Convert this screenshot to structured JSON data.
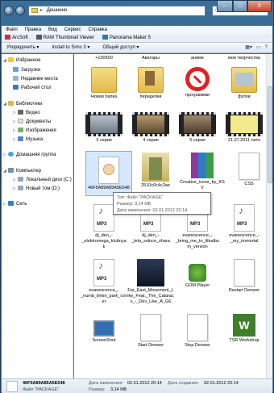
{
  "window": {
    "address": "Дешнино",
    "search_placeholder": "Поиск: Дешнино",
    "controls": {
      "minimize": "–",
      "maximize": "□",
      "close": "X"
    }
  },
  "menu": [
    "Файл",
    "Правка",
    "Вид",
    "Сервис",
    "Справка"
  ],
  "favorites_bar": [
    "ArcSoft",
    "RAW Thumbnail Viewer",
    "Panorama Maker 5"
  ],
  "toolbar": {
    "organize": "Упорядочить ▾",
    "install": "Install to Sims 3 ▾",
    "share": "Общий доступ ▾"
  },
  "sidebar": {
    "favorites": "Избранное",
    "fav_items": [
      "Загрузки",
      "Недавние места",
      "Рабочий стол"
    ],
    "libraries": "Библиотеки",
    "lib_items": [
      "Видео",
      "Документы",
      "Изображения",
      "Музыка"
    ],
    "homegroup": "Домашняя группа",
    "computer": "Компьютер",
    "comp_items": [
      "Локальный диск (C:)",
      "Новый том (D:)"
    ],
    "network": "Сеть"
  },
  "files": [
    {
      "label": "+100500",
      "kind": "partial"
    },
    {
      "label": "Аватары",
      "kind": "partial"
    },
    {
      "label": "аниме",
      "kind": "partial"
    },
    {
      "label": "мои творчества",
      "kind": "partial"
    },
    {
      "label": "Новая папка",
      "kind": "folder"
    },
    {
      "label": "переделки",
      "kind": "folder"
    },
    {
      "label": "программки",
      "kind": "folder"
    },
    {
      "label": "фотки",
      "kind": "folder"
    },
    {
      "label": "3 серия",
      "kind": "video"
    },
    {
      "label": "4 серия",
      "kind": "video"
    },
    {
      "label": "5 серия",
      "kind": "video"
    },
    {
      "label": "21.07.2011 лето",
      "kind": "video"
    },
    {
      "label": "46F5A89A85A5E548",
      "kind": "package"
    },
    {
      "label": "2510c0c4c2ae",
      "kind": "image"
    },
    {
      "label": "Creative_icons_by_KSV",
      "kind": "archive"
    },
    {
      "label": "CSS",
      "kind": "doc"
    },
    {
      "label": "dj_den_-_elektromega_klubnyak",
      "kind": "mp3"
    },
    {
      "label": "dj_den_-_leto_solnce_zhara",
      "kind": "mp3"
    },
    {
      "label": "evanescence_-_bring_me_to_lifealbum_version",
      "kind": "mp3"
    },
    {
      "label": "evanescence_-_my_immortal",
      "kind": "mp3"
    },
    {
      "label": "evanescence_-_numb_linkin_park_cover",
      "kind": "mp3"
    },
    {
      "label": "Far_East_Movement_Like_Feat._The_Cataracs_-_Dev_Like_A_G6",
      "kind": "mp3art"
    },
    {
      "label": "GOM Player",
      "kind": "shortcut"
    },
    {
      "label": "Restart Denwer",
      "kind": "doc"
    },
    {
      "label": "ScreenShot",
      "kind": "app"
    },
    {
      "label": "Start Denwer",
      "kind": "doc"
    },
    {
      "label": "Stop Denwer",
      "kind": "doc"
    },
    {
      "label": "TSR Workshop",
      "kind": "tsr"
    }
  ],
  "tooltip": {
    "type": "Тип: Файл \"PACKAGE\"",
    "size": "Размер: 3,14 МБ",
    "changed": "Дата изменения: 02.01.2012 20:14"
  },
  "details": {
    "name": "46F5A89A85A5E548",
    "changed_label": "Дата изменения:",
    "changed": "02.01.2012 20:14",
    "created_label": "Дата создания:",
    "created": "02.01.2012 20:14",
    "type": "Файл \"PACKAGE\"",
    "size_label": "Размер:",
    "size": "3,14 МБ"
  }
}
